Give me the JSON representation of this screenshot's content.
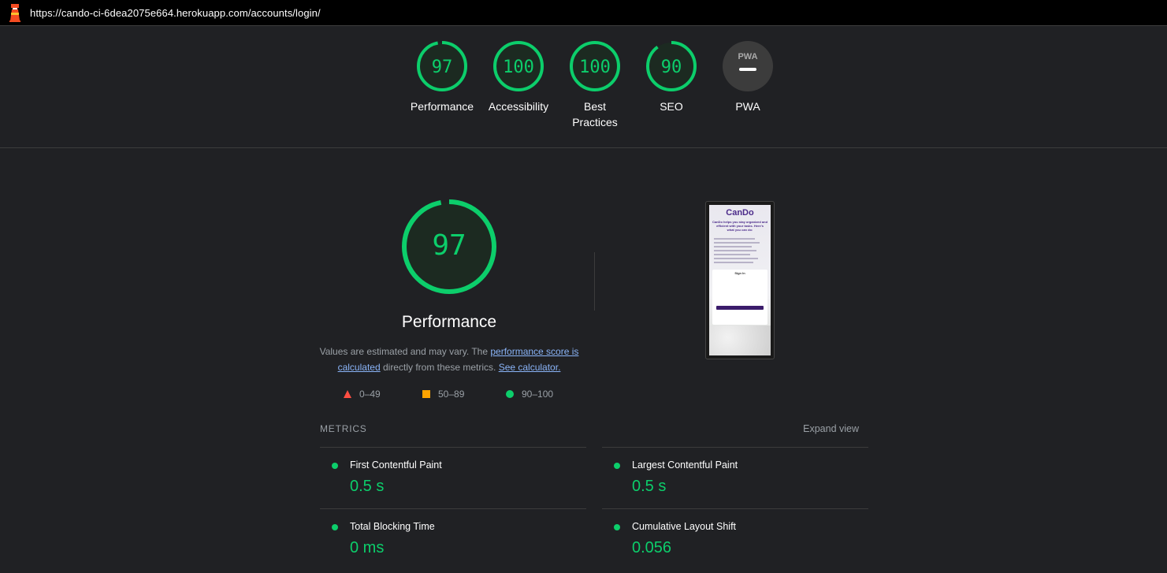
{
  "topbar": {
    "url": "https://cando-ci-6dea2075e664.herokuapp.com/accounts/login/"
  },
  "gauges": [
    {
      "score": "97",
      "label": "Performance"
    },
    {
      "score": "100",
      "label": "Accessibility"
    },
    {
      "score": "100",
      "label": "Best Practices"
    },
    {
      "score": "90",
      "label": "SEO"
    },
    {
      "score": "",
      "label": "PWA",
      "badge": "PWA"
    }
  ],
  "performance": {
    "score": "97",
    "title": "Performance",
    "desc_prefix": "Values are estimated and may vary. The ",
    "link_score": "performance score is calculated",
    "desc_middle": " directly from these metrics. ",
    "link_calc": "See calculator."
  },
  "legend": {
    "fail": "0–49",
    "average": "50–89",
    "pass": "90–100"
  },
  "metrics": {
    "header": "METRICS",
    "expand": "Expand view",
    "items": [
      {
        "name": "First Contentful Paint",
        "value": "0.5 s"
      },
      {
        "name": "Largest Contentful Paint",
        "value": "0.5 s"
      },
      {
        "name": "Total Blocking Time",
        "value": "0 ms"
      },
      {
        "name": "Cumulative Layout Shift",
        "value": "0.056"
      }
    ]
  },
  "screenshot": {
    "brand": "CanDo",
    "tagline": "CanDo helps you stay organized and efficient with your tasks. Here's what you can do:",
    "card_title": "Sign In"
  },
  "colors": {
    "pass": "#0cce6b",
    "average": "#ffa400",
    "fail": "#ff4e42",
    "link": "#8ab4f8"
  }
}
